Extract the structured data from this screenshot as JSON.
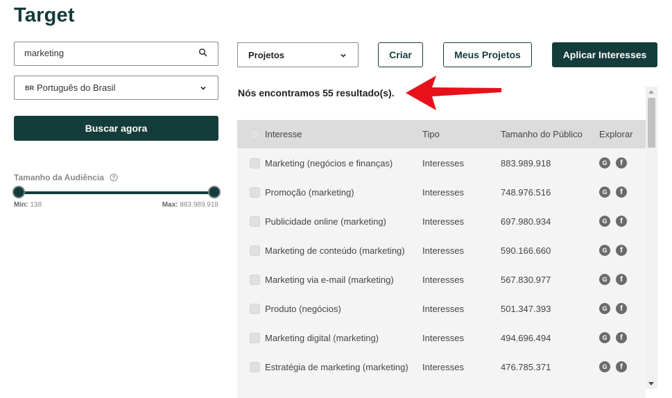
{
  "app": {
    "title": "Target"
  },
  "search": {
    "value": "marketing"
  },
  "language": {
    "flag": "BR",
    "label": "Português do Brasil"
  },
  "buttons": {
    "search": "Buscar agora",
    "projects": "Projetos",
    "create": "Criar",
    "my_projects": "Meus Projetos",
    "apply": "Aplicar Interesses"
  },
  "audience": {
    "label": "Tamanho da Audiência",
    "min_label": "Min:",
    "min_value": "138",
    "max_label": "Max:",
    "max_value": "883.989.918"
  },
  "results": {
    "text": "Nós encontramos 55 resultado(s)."
  },
  "table": {
    "headers": {
      "interest": "Interesse",
      "type": "Tipo",
      "size": "Tamanho do Público",
      "explore": "Explorar"
    },
    "rows": [
      {
        "interest": "Marketing (negócios e finanças)",
        "type": "Interesses",
        "size": "883.989.918"
      },
      {
        "interest": "Promoção (marketing)",
        "type": "Interesses",
        "size": "748.976.516"
      },
      {
        "interest": "Publicidade online (marketing)",
        "type": "Interesses",
        "size": "697.980.934"
      },
      {
        "interest": "Marketing de conteúdo (marketing)",
        "type": "Interesses",
        "size": "590.166.660"
      },
      {
        "interest": "Marketing via e-mail (marketing)",
        "type": "Interesses",
        "size": "567.830.977"
      },
      {
        "interest": "Produto (negócios)",
        "type": "Interesses",
        "size": "501.347.393"
      },
      {
        "interest": "Marketing digital (marketing)",
        "type": "Interesses",
        "size": "494.696.494"
      },
      {
        "interest": "Estratégia de marketing (marketing)",
        "type": "Interesses",
        "size": "476.785.371"
      }
    ]
  },
  "colors": {
    "brand": "#143c3a",
    "annotation_arrow": "#e8101a"
  }
}
